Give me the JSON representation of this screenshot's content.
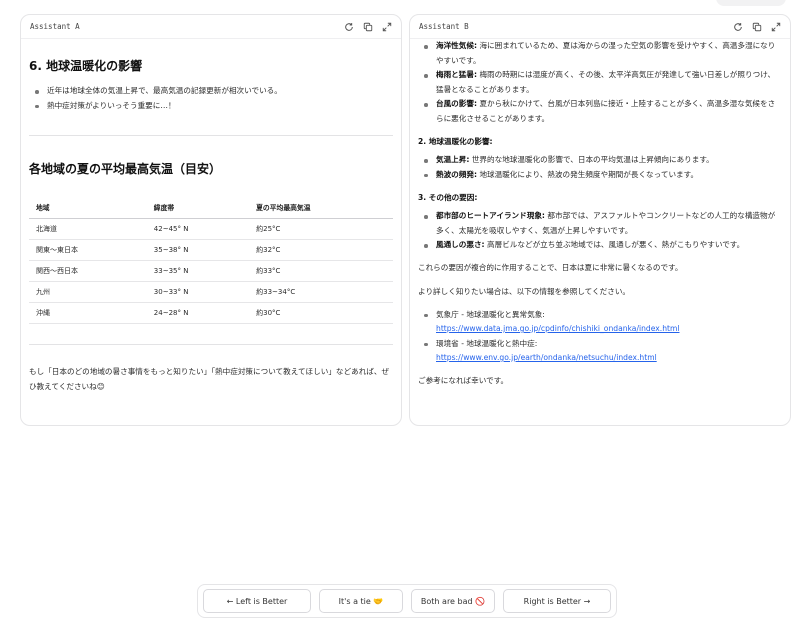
{
  "panel_a": {
    "title": "Assistant A",
    "heading": "6. 地球温暖化の影響",
    "bullets": [
      "近年は地球全体の気温上昇で、最高気温の記録更新が相次いでいる。",
      "熱中症対策がよりいっそう重要に…！"
    ],
    "table_heading": "各地域の夏の平均最高気温（目安）",
    "table": {
      "headers": [
        "地域",
        "緯度帯",
        "夏の平均最高気温"
      ],
      "rows": [
        [
          "北海道",
          "42~45° N",
          "約25°C"
        ],
        [
          "関東～東日本",
          "35~38° N",
          "約32°C"
        ],
        [
          "関西～西日本",
          "33~35° N",
          "約33°C"
        ],
        [
          "九州",
          "30~33° N",
          "約33~34°C"
        ],
        [
          "沖縄",
          "24~28° N",
          "約30°C"
        ]
      ]
    },
    "closing": "もし「日本のどの地域の暑さ事情をもっと知りたい」「熱中症対策について教えてほしい」などあれば、ぜひ教えてくださいね😊"
  },
  "panel_b": {
    "title": "Assistant B",
    "climate_items": [
      {
        "term": "海洋性気候:",
        "text": "海に囲まれているため、夏は海からの湿った空気の影響を受けやすく、高温多湿になりやすいです。"
      },
      {
        "term": "梅雨と猛暑:",
        "text": "梅雨の時期には湿度が高く、その後、太平洋高気圧が発達して強い日差しが照りつけ、猛暑となることがあります。"
      },
      {
        "term": "台風の影響:",
        "text": "夏から秋にかけて、台風が日本列島に接近・上陸することが多く、高温多湿な気候をさらに悪化させることがあります。"
      }
    ],
    "section2_heading": "2. 地球温暖化の影響:",
    "section2_items": [
      {
        "term": "気温上昇:",
        "text": "世界的な地球温暖化の影響で、日本の平均気温は上昇傾向にあります。"
      },
      {
        "term": "熱波の頻発:",
        "text": "地球温暖化により、熱波の発生頻度や期間が長くなっています。"
      }
    ],
    "section3_heading": "3. その他の要因:",
    "section3_items": [
      {
        "term": "都市部のヒートアイランド現象:",
        "text": "都市部では、アスファルトやコンクリートなどの人工的な構造物が多く、太陽光を吸収しやすく、気温が上昇しやすいです。"
      },
      {
        "term": "風通しの悪さ:",
        "text": "高層ビルなどが立ち並ぶ地域では、風通しが悪く、熱がこもりやすいです。"
      }
    ],
    "summary": "これらの要因が複合的に作用することで、日本は夏に非常に暑くなるのです。",
    "more_info": "より詳しく知りたい場合は、以下の情報を参照してください。",
    "links": [
      {
        "label": "気象庁 - 地球温暖化と異常気象:",
        "url": "https://www.data.jma.go.jp/cpdinfo/chishiki_ondanka/index.html"
      },
      {
        "label": "環境省 - 地球温暖化と熱中症:",
        "url": "https://www.env.go.jp/earth/ondanka/netsuchu/index.html"
      }
    ],
    "closing": "ご参考になれば幸いです。"
  },
  "vote_bar": {
    "left_label": "← Left is Better",
    "tie_label": "It's a tie 🤝",
    "bad_label": "Both are bad 🚫",
    "right_label": "Right is Better →"
  }
}
